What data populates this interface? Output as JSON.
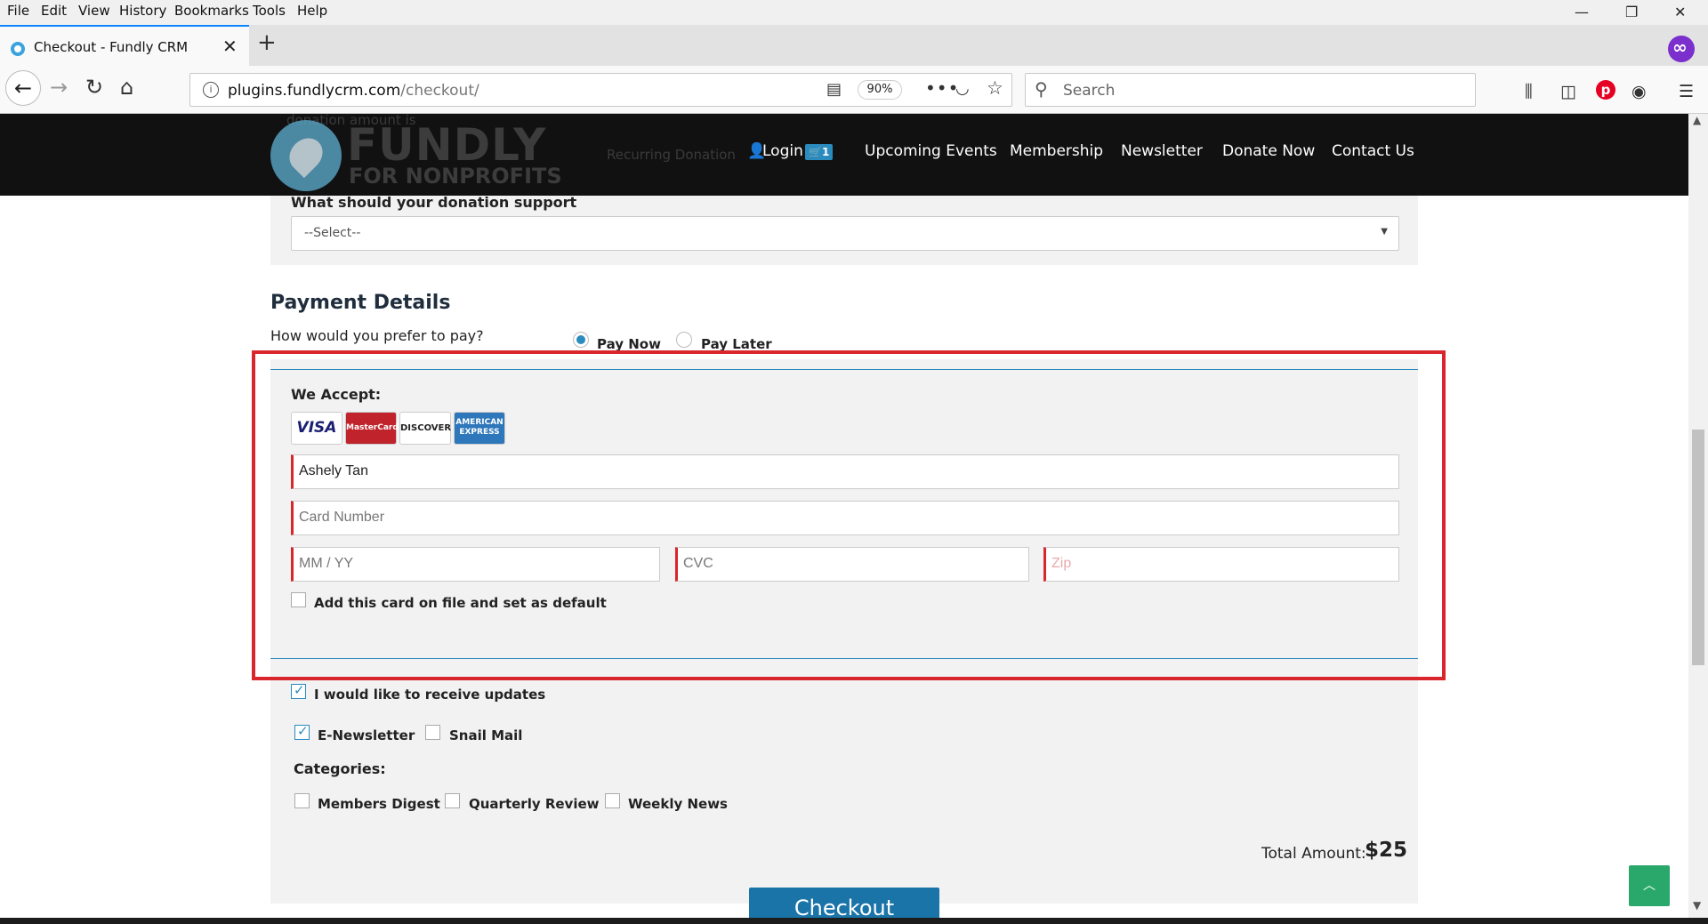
{
  "browser": {
    "menu": [
      "File",
      "Edit",
      "View",
      "History",
      "Bookmarks",
      "Tools",
      "Help"
    ],
    "tab_title": "Checkout - Fundly CRM",
    "url_domain": "plugins.fundlycrm.com",
    "url_path": "/checkout/",
    "zoom": "90%",
    "search_placeholder": "Search"
  },
  "site": {
    "logo_main": "FUNDLY",
    "logo_sub": "FOR NONPROFITS",
    "ghost_text_1": "donation amount is",
    "ghost_text_2": "Recurring Donation",
    "nav": {
      "login": "Login",
      "cart_count": "1",
      "upcoming_events": "Upcoming Events",
      "membership": "Membership",
      "newsletter": "Newsletter",
      "donate_now": "Donate Now",
      "contact_us": "Contact Us"
    }
  },
  "donation": {
    "support_label": "What should your donation support",
    "support_value": "--Select--"
  },
  "payment": {
    "heading": "Payment Details",
    "question": "How would you prefer to pay?",
    "pay_now": "Pay Now",
    "pay_later": "Pay Later",
    "selected": "Pay Now",
    "we_accept": "We Accept:",
    "cards": [
      "VISA",
      "MasterCard",
      "DISCOVER",
      "AMERICAN EXPRESS"
    ],
    "name_value": "Ashely Tan",
    "card_number_placeholder": "Card Number",
    "expiry_placeholder": "MM / YY",
    "cvc_placeholder": "CVC",
    "zip_placeholder": "Zip",
    "save_card_label": "Add this card on file and set as default"
  },
  "updates": {
    "receive_updates": "I would like to receive updates",
    "receive_updates_checked": true,
    "enewsletter": "E-Newsletter",
    "enewsletter_checked": true,
    "snail_mail": "Snail Mail",
    "snail_mail_checked": false,
    "categories_label": "Categories:",
    "categories": [
      "Members Digest",
      "Quarterly Review",
      "Weekly News"
    ]
  },
  "total": {
    "label": "Total Amount:",
    "value": "$25"
  },
  "checkout_label": "Checkout",
  "colors": {
    "accent": "#2a8bbf",
    "highlight_box": "#d9262c",
    "checkout_button": "#1a74a8"
  }
}
